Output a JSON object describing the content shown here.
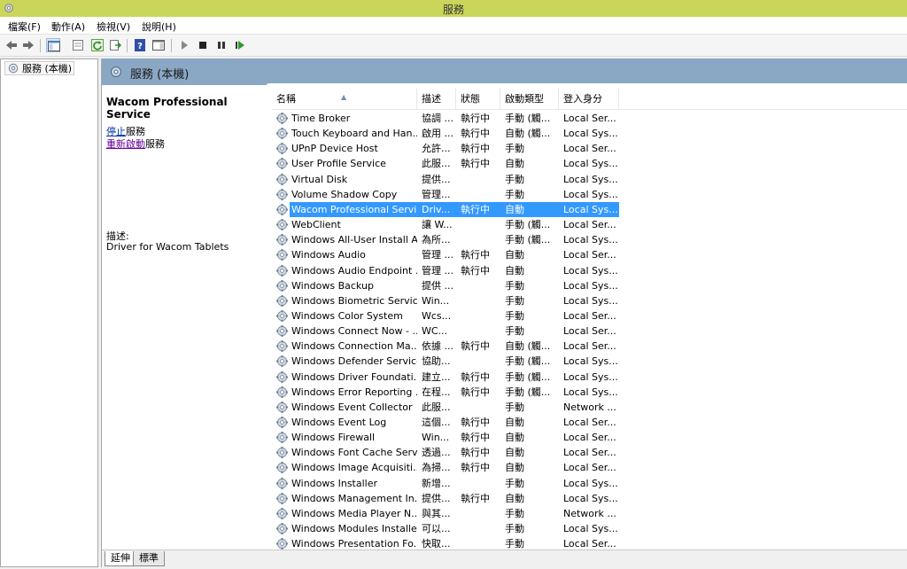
{
  "window": {
    "title": "服務"
  },
  "menu": [
    "檔案(F)",
    "動作(A)",
    "檢視(V)",
    "說明(H)"
  ],
  "toolbar": {
    "buttons": [
      "back-icon",
      "forward-icon",
      "show-hide-console-tree-icon",
      "properties-icon",
      "refresh-icon",
      "export-list-icon",
      "help-icon",
      "show-action-pane-icon",
      "start-service-icon",
      "stop-service-icon",
      "pause-service-icon",
      "restart-service-icon"
    ]
  },
  "tree": {
    "root": "服務 (本機)"
  },
  "header": {
    "title": "服務 (本機)"
  },
  "detail": {
    "service_name": "Wacom Professional Service",
    "stop_link": "停止",
    "stop_suffix": "服務",
    "restart_link": "重新啟動",
    "restart_suffix": "服務",
    "desc_label": "描述:",
    "desc_text": "Driver for Wacom Tablets"
  },
  "columns": [
    "名稱",
    "描述",
    "狀態",
    "啟動類型",
    "登入身分"
  ],
  "rows": [
    {
      "name": "Time Broker",
      "desc": "協調 ...",
      "status": "執行中",
      "startup": "手動 (觸...",
      "logon": "Local Ser..."
    },
    {
      "name": "Touch Keyboard and Han...",
      "desc": "啟用 ...",
      "status": "執行中",
      "startup": "自動 (觸...",
      "logon": "Local Sys..."
    },
    {
      "name": "UPnP Device Host",
      "desc": "允許...",
      "status": "執行中",
      "startup": "手動",
      "logon": "Local Ser..."
    },
    {
      "name": "User Profile Service",
      "desc": "此服...",
      "status": "執行中",
      "startup": "自動",
      "logon": "Local Sys..."
    },
    {
      "name": "Virtual Disk",
      "desc": "提供...",
      "status": "",
      "startup": "手動",
      "logon": "Local Sys..."
    },
    {
      "name": "Volume Shadow Copy",
      "desc": "管理...",
      "status": "",
      "startup": "手動",
      "logon": "Local Sys..."
    },
    {
      "name": "Wacom Professional Servi...",
      "desc": "Driv...",
      "status": "執行中",
      "startup": "自動",
      "logon": "Local Sys...",
      "selected": true
    },
    {
      "name": "WebClient",
      "desc": "讓 W...",
      "status": "",
      "startup": "手動 (觸...",
      "logon": "Local Ser..."
    },
    {
      "name": "Windows All-User Install A...",
      "desc": "為所...",
      "status": "",
      "startup": "手動 (觸...",
      "logon": "Local Sys..."
    },
    {
      "name": "Windows Audio",
      "desc": "管理 ...",
      "status": "執行中",
      "startup": "自動",
      "logon": "Local Ser..."
    },
    {
      "name": "Windows Audio Endpoint ...",
      "desc": "管理 ...",
      "status": "執行中",
      "startup": "自動",
      "logon": "Local Sys..."
    },
    {
      "name": "Windows Backup",
      "desc": "提供 ...",
      "status": "",
      "startup": "手動",
      "logon": "Local Sys..."
    },
    {
      "name": "Windows Biometric Service",
      "desc": "Win...",
      "status": "",
      "startup": "手動",
      "logon": "Local Sys..."
    },
    {
      "name": "Windows Color System",
      "desc": "Wcs...",
      "status": "",
      "startup": "手動",
      "logon": "Local Ser..."
    },
    {
      "name": "Windows Connect Now - ...",
      "desc": "WC...",
      "status": "",
      "startup": "手動",
      "logon": "Local Ser..."
    },
    {
      "name": "Windows Connection Ma...",
      "desc": "依據 ...",
      "status": "執行中",
      "startup": "自動 (觸...",
      "logon": "Local Ser..."
    },
    {
      "name": "Windows Defender Service",
      "desc": "協助...",
      "status": "",
      "startup": "手動 (觸...",
      "logon": "Local Sys..."
    },
    {
      "name": "Windows Driver Foundati...",
      "desc": "建立...",
      "status": "執行中",
      "startup": "手動 (觸...",
      "logon": "Local Sys..."
    },
    {
      "name": "Windows Error Reporting ...",
      "desc": "在程...",
      "status": "執行中",
      "startup": "手動 (觸...",
      "logon": "Local Sys..."
    },
    {
      "name": "Windows Event Collector",
      "desc": "此服...",
      "status": "",
      "startup": "手動",
      "logon": "Network ..."
    },
    {
      "name": "Windows Event Log",
      "desc": "這個...",
      "status": "執行中",
      "startup": "自動",
      "logon": "Local Ser..."
    },
    {
      "name": "Windows Firewall",
      "desc": "Win...",
      "status": "執行中",
      "startup": "自動",
      "logon": "Local Ser..."
    },
    {
      "name": "Windows Font Cache Serv...",
      "desc": "透過...",
      "status": "執行中",
      "startup": "自動",
      "logon": "Local Ser..."
    },
    {
      "name": "Windows Image Acquisiti...",
      "desc": "為掃...",
      "status": "執行中",
      "startup": "自動",
      "logon": "Local Ser..."
    },
    {
      "name": "Windows Installer",
      "desc": "新增...",
      "status": "",
      "startup": "手動",
      "logon": "Local Sys..."
    },
    {
      "name": "Windows Management In...",
      "desc": "提供...",
      "status": "執行中",
      "startup": "自動",
      "logon": "Local Sys..."
    },
    {
      "name": "Windows Media Player N...",
      "desc": "與其...",
      "status": "",
      "startup": "手動",
      "logon": "Network ..."
    },
    {
      "name": "Windows Modules Installer",
      "desc": "可以...",
      "status": "",
      "startup": "手動",
      "logon": "Local Sys..."
    },
    {
      "name": "Windows Presentation Fo...",
      "desc": "快取...",
      "status": "",
      "startup": "手動",
      "logon": "Local Ser..."
    }
  ],
  "tabs": [
    "延伸",
    "標準"
  ],
  "colors": {
    "titlebar": "#c9d65a",
    "header_band": "#8aa7c4",
    "selection": "#3399ff"
  }
}
